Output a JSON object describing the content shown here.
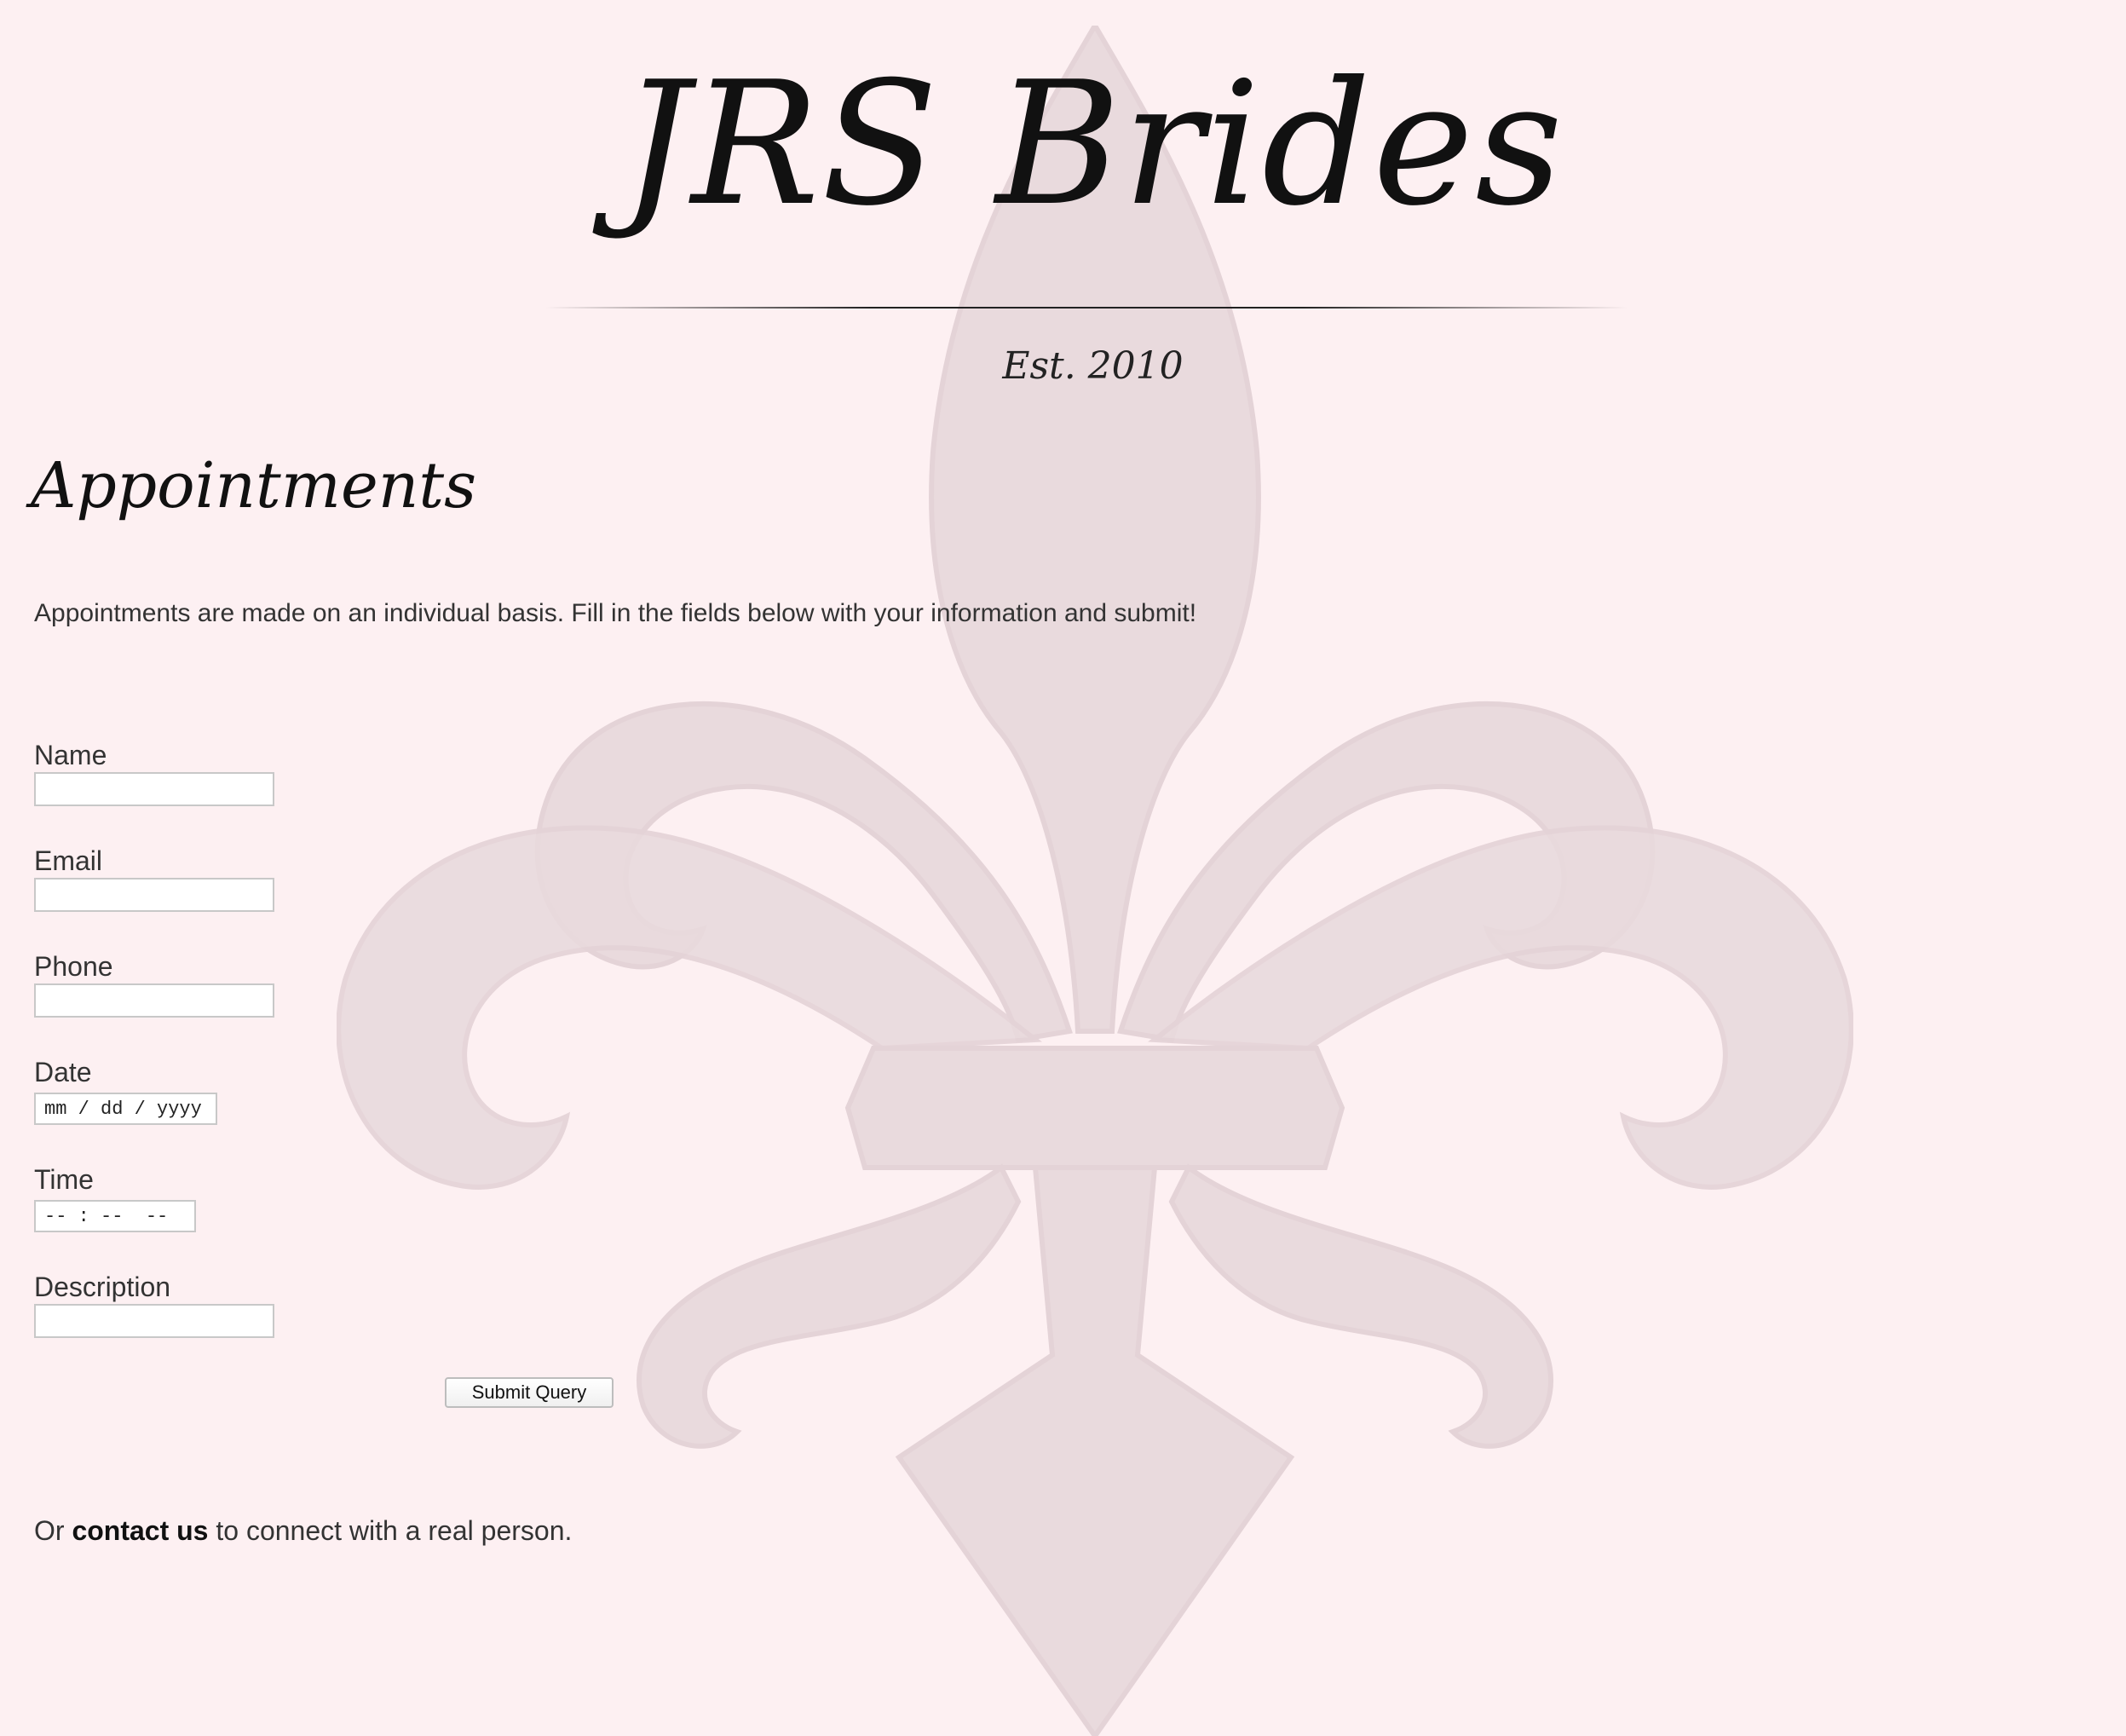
{
  "header": {
    "brand_name": "JRS Brides",
    "established": "Est. 2010"
  },
  "main": {
    "title": "Appointments",
    "intro": "Appointments are made on an individual basis. Fill in the fields below with your information and submit!"
  },
  "form": {
    "name_label": "Name",
    "name_value": "",
    "email_label": "Email",
    "email_value": "",
    "phone_label": "Phone",
    "phone_value": "",
    "date_label": "Date",
    "date_placeholder": "mm / dd / yyyy",
    "time_label": "Time",
    "time_placeholder": "-- : --  --",
    "description_label": "Description",
    "description_value": "",
    "submit_label": "Submit Query"
  },
  "footer": {
    "prefix": "Or",
    "link_text": "contact us",
    "suffix": "to connect with a real person."
  },
  "colors": {
    "background": "#fdf0f2",
    "watermark": "#e9dadd",
    "text": "#333333"
  },
  "icons": {
    "watermark": "fleur-de-lis-icon"
  }
}
